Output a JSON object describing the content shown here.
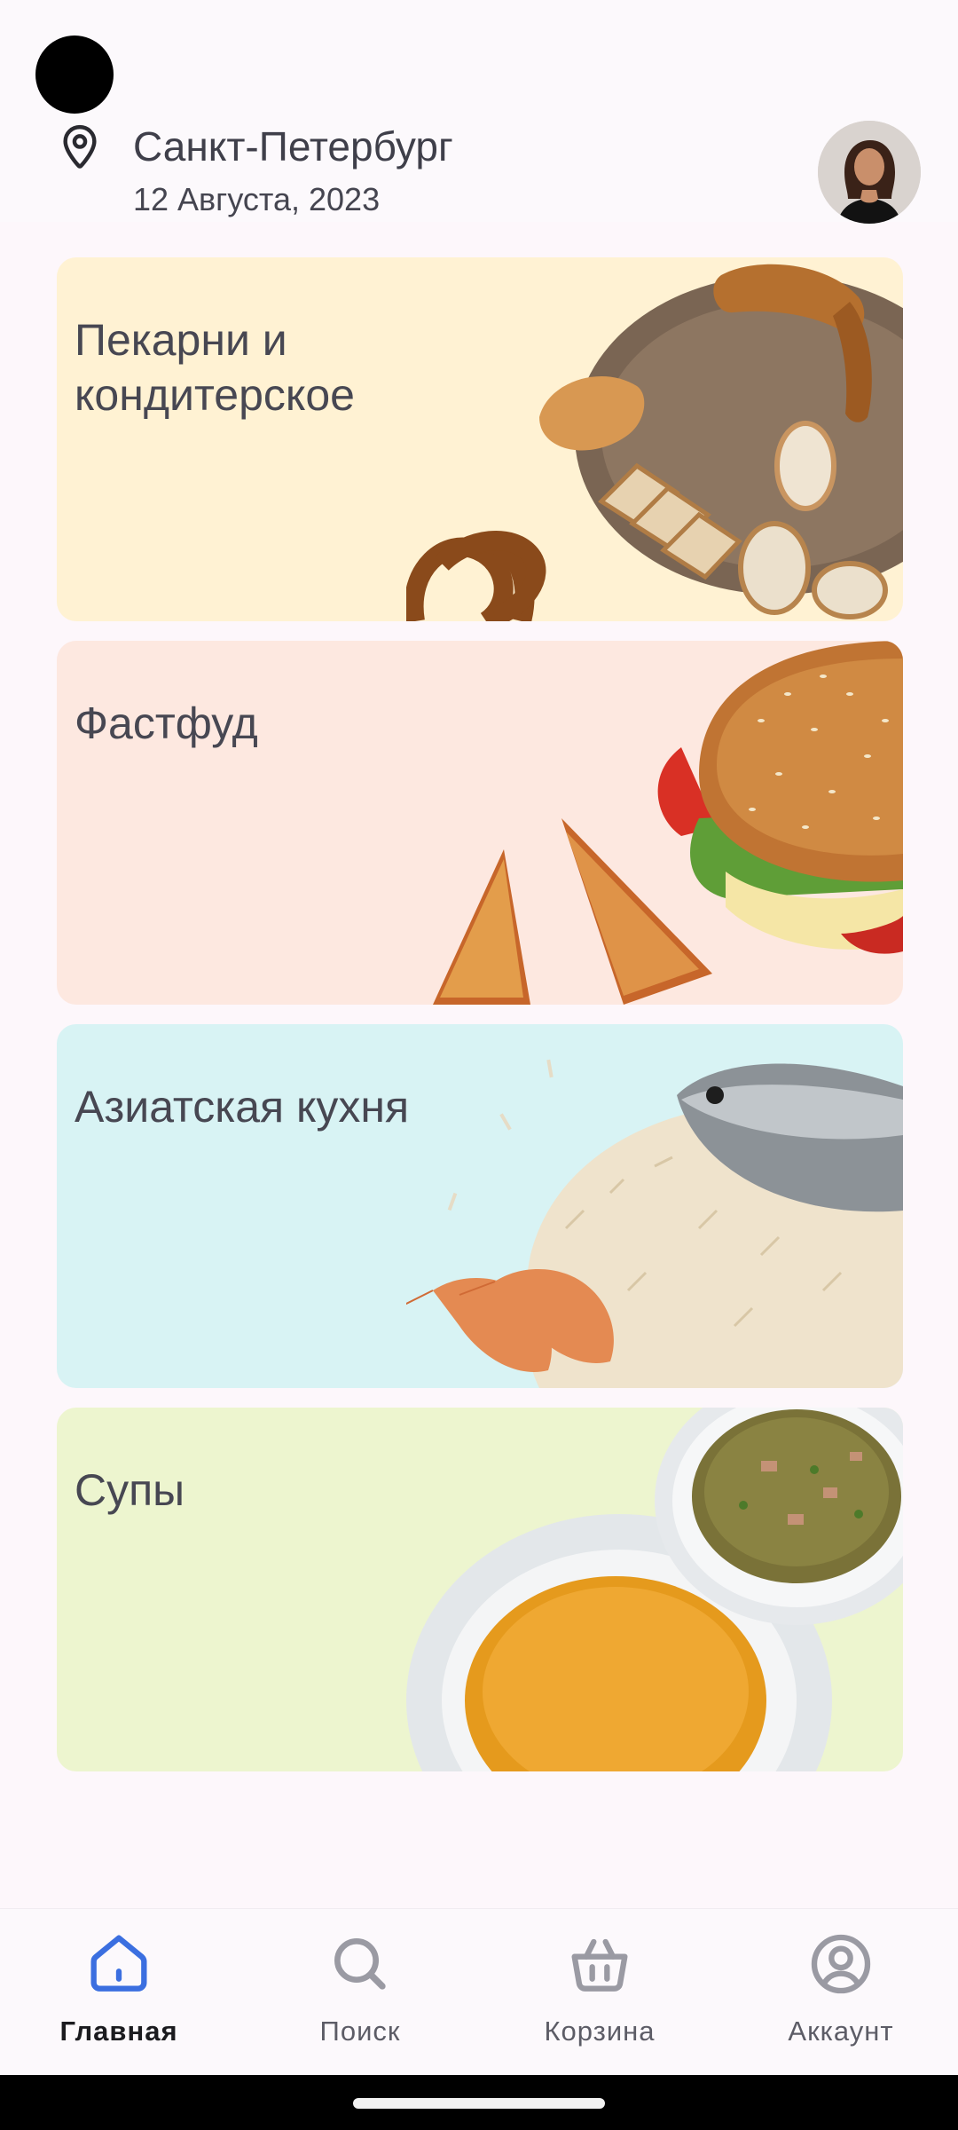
{
  "header": {
    "city": "Санкт-Петербург",
    "date": "12 Августа, 2023"
  },
  "categories": [
    {
      "label": "Пекарни и кондитерское",
      "bg": "#fff2d3"
    },
    {
      "label": "Фастфуд",
      "bg": "#fde8e0"
    },
    {
      "label": "Азиатская кухня",
      "bg": "#d8f3f4"
    },
    {
      "label": "Супы",
      "bg": "#edf5cf"
    }
  ],
  "bottom_nav": [
    {
      "label": "Главная",
      "icon": "home-icon",
      "active": true
    },
    {
      "label": "Поиск",
      "icon": "search-icon",
      "active": false
    },
    {
      "label": "Корзина",
      "icon": "basket-icon",
      "active": false
    },
    {
      "label": "Аккаунт",
      "icon": "account-icon",
      "active": false
    }
  ],
  "colors": {
    "active_icon": "#3b6fe0",
    "inactive_icon": "#9a9aa3"
  }
}
